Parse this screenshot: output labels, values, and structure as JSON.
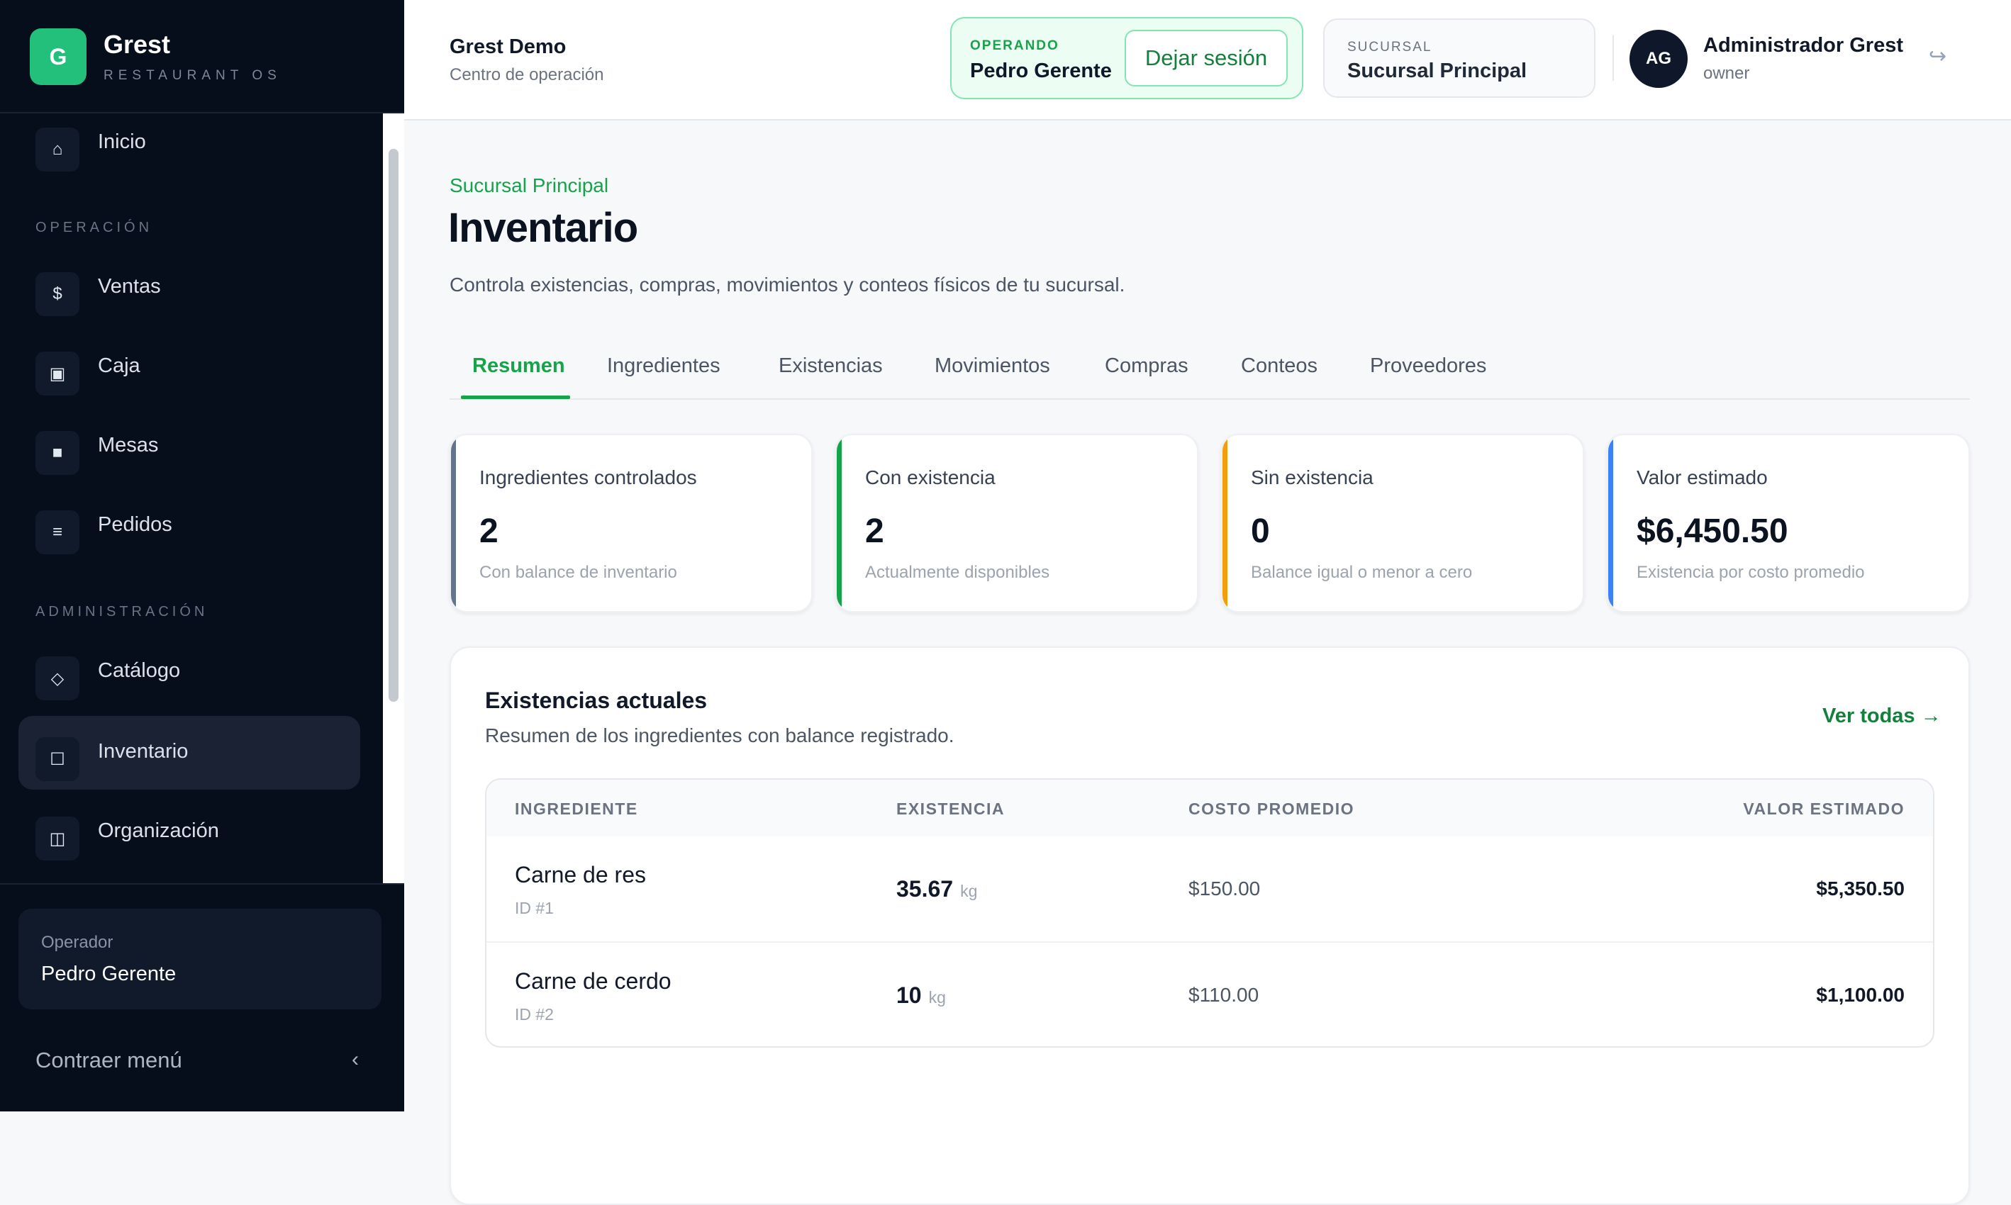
{
  "brand": {
    "logo_letter": "G",
    "name": "Grest",
    "subtitle": "RESTAURANT OS"
  },
  "sidebar": {
    "home": {
      "label": "Inicio",
      "icon": "⌂"
    },
    "section_operacion": "OPERACIÓN",
    "operacion_items": [
      {
        "label": "Ventas",
        "icon": "$"
      },
      {
        "label": "Caja",
        "icon": "▣"
      },
      {
        "label": "Mesas",
        "icon": "■"
      },
      {
        "label": "Pedidos",
        "icon": "≡"
      }
    ],
    "section_admin": "ADMINISTRACIÓN",
    "admin_items": [
      {
        "label": "Catálogo",
        "icon": "◇"
      },
      {
        "label": "Inventario",
        "icon": "☐",
        "active": true
      },
      {
        "label": "Organización",
        "icon": "◫"
      }
    ],
    "operator_caption": "Operador",
    "operator_name": "Pedro Gerente",
    "collapse_label": "Contraer menú",
    "collapse_icon": "‹"
  },
  "header": {
    "title": "Grest Demo",
    "subtitle": "Centro de operación",
    "operating_caption": "OPERANDO",
    "operating_name": "Pedro Gerente",
    "leave_button": "Dejar sesión",
    "branch_caption": "SUCURSAL",
    "branch_name": "Sucursal Principal",
    "avatar_initials": "AG",
    "user_name": "Administrador Grest",
    "user_role": "owner",
    "logout_icon": "↪"
  },
  "main": {
    "breadcrumb": "Sucursal Principal",
    "title": "Inventario",
    "description": "Controla existencias, compras, movimientos y conteos físicos de tu sucursal.",
    "tabs": [
      "Resumen",
      "Ingredientes",
      "Existencias",
      "Movimientos",
      "Compras",
      "Conteos",
      "Proveedores"
    ],
    "active_tab": "Resumen",
    "stats": [
      {
        "label": "Ingredientes controlados",
        "value": "2",
        "note": "Con balance de inventario",
        "color": "#64748b"
      },
      {
        "label": "Con existencia",
        "value": "2",
        "note": "Actualmente disponibles",
        "color": "#16a34a"
      },
      {
        "label": "Sin existencia",
        "value": "0",
        "note": "Balance igual o menor a cero",
        "color": "#f59e0b"
      },
      {
        "label": "Valor estimado",
        "value": "$6,450.50",
        "note": "Existencia por costo promedio",
        "color": "#3b82f6"
      }
    ],
    "stock_panel": {
      "title": "Existencias actuales",
      "subtitle": "Resumen de los ingredientes con balance registrado.",
      "link": "Ver todas →",
      "columns": [
        "INGREDIENTE",
        "EXISTENCIA",
        "COSTO PROMEDIO",
        "VALOR ESTIMADO"
      ],
      "rows": [
        {
          "name": "Carne de res",
          "id": "ID #1",
          "qty": "35.67",
          "unit": "kg",
          "cost": "$150.00",
          "value": "$5,350.50"
        },
        {
          "name": "Carne de cerdo",
          "id": "ID #2",
          "qty": "10",
          "unit": "kg",
          "cost": "$110.00",
          "value": "$1,100.00"
        }
      ]
    }
  }
}
